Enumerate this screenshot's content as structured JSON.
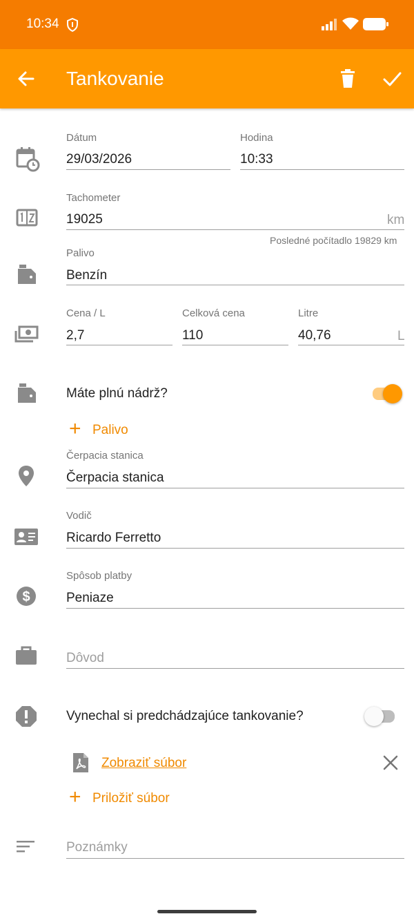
{
  "status_bar": {
    "time": "10:34"
  },
  "app_bar": {
    "title": "Tankovanie"
  },
  "form": {
    "date": {
      "label": "Dátum",
      "value": "29/03/2026"
    },
    "time": {
      "label": "Hodina",
      "value": "10:33"
    },
    "odometer": {
      "label": "Tachometer",
      "value": "19025",
      "unit": "km",
      "helper": "Posledné počítadlo 19829 km"
    },
    "fuel": {
      "label": "Palivo",
      "value": "Benzín"
    },
    "price_per_l": {
      "label": "Cena / L",
      "value": "2,7"
    },
    "total_price": {
      "label": "Celková cena",
      "value": "110"
    },
    "liters": {
      "label": "Litre",
      "value": "40,76",
      "unit": "L"
    },
    "full_tank": {
      "label": "Máte plnú nádrž?",
      "checked": true
    },
    "add_fuel": {
      "label": "Palivo"
    },
    "station": {
      "label": "Čerpacia stanica",
      "value": "Čerpacia stanica"
    },
    "driver": {
      "label": "Vodič",
      "value": "Ricardo Ferretto"
    },
    "payment": {
      "label": "Spôsob platby",
      "value": "Peniaze"
    },
    "reason": {
      "placeholder": "Dôvod"
    },
    "missed": {
      "label": "Vynechal si predchádzajúce tankovanie?",
      "checked": false
    },
    "file": {
      "link": "Zobraziť súbor"
    },
    "attach": {
      "label": "Priložiť súbor"
    },
    "notes": {
      "placeholder": "Poznámky"
    }
  },
  "colors": {
    "accent": "#ff9800",
    "status": "#f57c00",
    "icon": "#8a8a8a"
  }
}
